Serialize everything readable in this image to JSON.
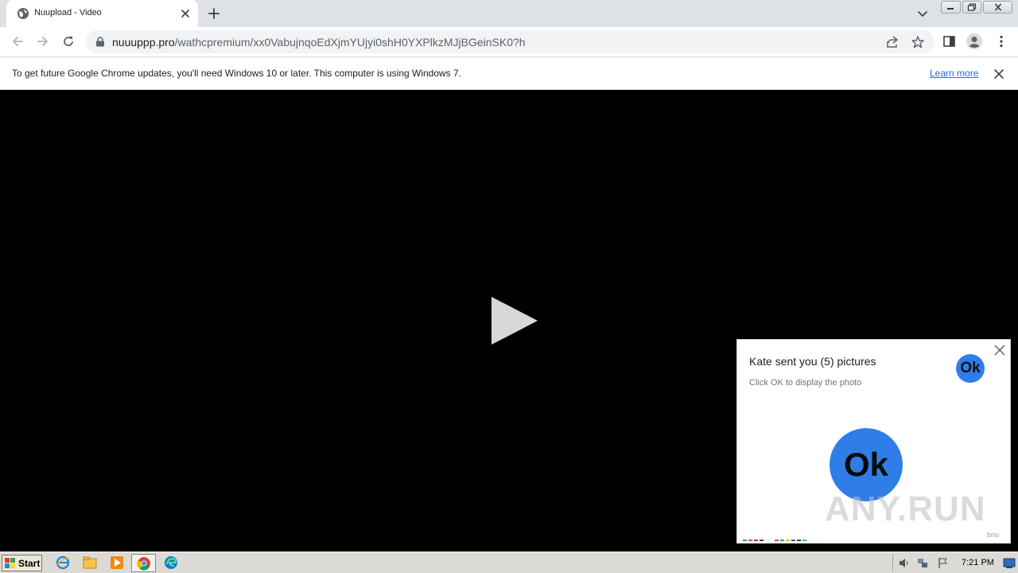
{
  "tab": {
    "title": "Nuupload - Video"
  },
  "omnibox": {
    "host": "nuuuppp.pro",
    "path": "/wathcpremium/xx0VabujnqoEdXjmYUjyi0shH0YXPlkzMJjBGeinSK0?h"
  },
  "infobar": {
    "message": "To get future Google Chrome updates, you'll need Windows 10 or later. This computer is using Windows 7.",
    "link": "Learn more"
  },
  "popup": {
    "title": "Kate sent you (5) pictures",
    "subtitle": "Click OK to display the photo",
    "ok_small": "Ok",
    "ok_big": "Ok",
    "brand": "bnu",
    "watermark": "ANY.RUN"
  },
  "taskbar": {
    "start_label": "Start",
    "clock": "7:21 PM"
  },
  "colors": {
    "accent": "#1a73e8",
    "ok_button": "#2f7ee8",
    "page_bg": "#000000"
  }
}
